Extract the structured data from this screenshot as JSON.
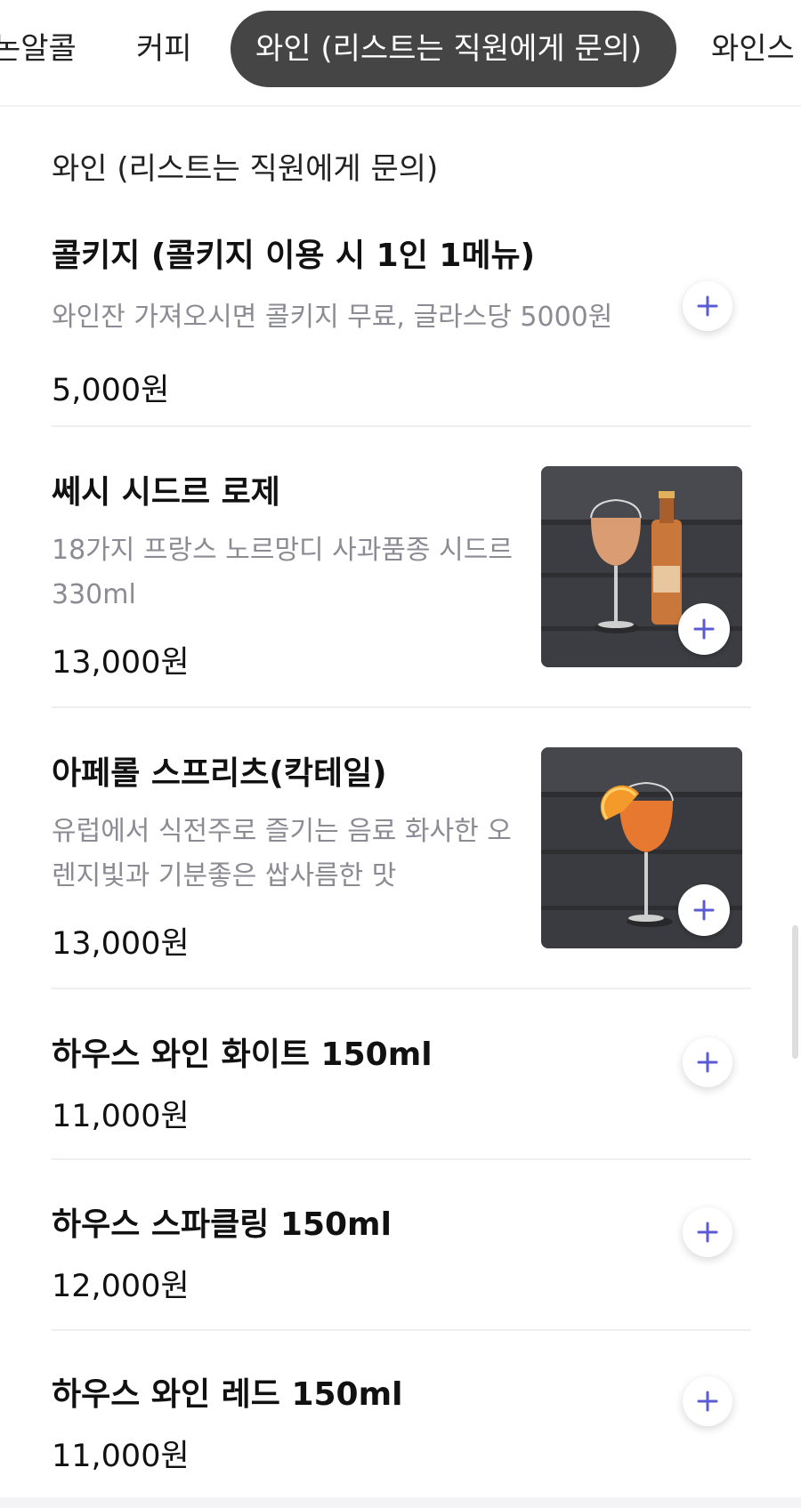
{
  "tabs": [
    {
      "label": "논알콜",
      "active": false
    },
    {
      "label": "커피",
      "active": false
    },
    {
      "label": "와인 (리스트는 직원에게 문의)",
      "active": true
    },
    {
      "label": "와인스",
      "active": false
    }
  ],
  "section": {
    "title": "와인 (리스트는 직원에게 문의)"
  },
  "items": [
    {
      "name": "콜키지 (콜키지 이용 시 1인 1메뉴)",
      "description": "와인잔 가져오시면 콜키지 무료, 글라스당 5000원",
      "price": "5,000원",
      "image": null
    },
    {
      "name": "쎄시 시드르 로제",
      "description_lines": [
        "18가지 프랑스 노르망디 사과품종 시드르",
        "330ml"
      ],
      "price": "13,000원",
      "image": "rose-cider-glass-and-bottle"
    },
    {
      "name": "아페롤 스프리츠(칵테일)",
      "description_lines": [
        "유럽에서 식전주로 즐기는 음료 화사한 오",
        "렌지빛과 기분좋은 쌉사름한 맛"
      ],
      "price": "13,000원",
      "image": "aperol-spritz-glass-with-orange"
    },
    {
      "name": "하우스 와인 화이트 150ml",
      "price": "11,000원",
      "image": null
    },
    {
      "name": "하우스 스파클링 150ml",
      "price": "12,000원",
      "image": null
    },
    {
      "name": "하우스 와인 레드 150ml",
      "price": "11,000원",
      "image": null
    }
  ],
  "colors": {
    "accent": "#5b5bd6",
    "active_tab_bg": "#454545",
    "description": "#8b8b93",
    "divider": "#eeeef1"
  },
  "icons": {
    "add": "plus-icon"
  }
}
